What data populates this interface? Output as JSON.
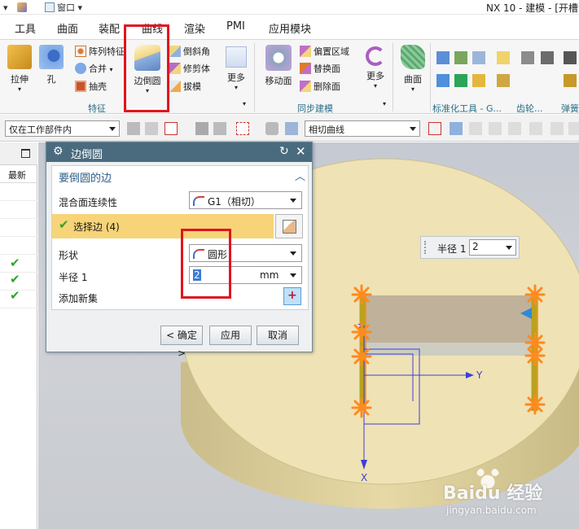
{
  "titlebar": {
    "window_label": "窗口",
    "title": "NX 10 - 建模 - [开槽"
  },
  "menu": {
    "tabs": [
      "工具",
      "曲面",
      "装配",
      "曲线",
      "渲染",
      "PMI",
      "应用模块"
    ]
  },
  "ribbon": {
    "extrude": "拉伸",
    "hole": "孔",
    "pattern": "阵列特征",
    "unite": "合并",
    "shell": "抽壳",
    "edge_blend": "边倒圆",
    "chamfer": "倒斜角",
    "trim_body": "修剪体",
    "draft": "拔模",
    "more1": "更多",
    "group_feature": "特征",
    "move_face": "移动面",
    "offset_region": "偏置区域",
    "replace_face": "替换面",
    "delete_face": "删除面",
    "more2": "更多",
    "group_sync": "同步建模",
    "surface": "曲面",
    "group_std": "标准化工具 - G...",
    "group_gear": "齿轮...",
    "group_spring": "弹簧"
  },
  "selbar": {
    "filter": "仅在工作部件内",
    "curve_rule": "相切曲线"
  },
  "leftpanel": {
    "column": "最新"
  },
  "dialog": {
    "title": "边倒圆",
    "section": "要倒圆的边",
    "continuity_label": "混合面连续性",
    "continuity_value": "G1（相切）",
    "select_edge": "选择边 (4)",
    "shape_label": "形状",
    "shape_value": "圆形",
    "radius_label": "半径 1",
    "radius_value": "2",
    "radius_unit": "mm",
    "add_set_label": "添加新集",
    "ok": "< 确定 >",
    "apply": "应用",
    "cancel": "取消"
  },
  "floating": {
    "label": "半径 1",
    "value": "2"
  },
  "axes": {
    "x": "X",
    "y": "Y",
    "z": "Z"
  },
  "watermark": {
    "brand": "Baidu 经验",
    "url": "jingyan.baidu.com"
  },
  "colors": {
    "highlight": "#e0151f",
    "dialog_title": "#4a6b7e",
    "selection_row": "#f7d478",
    "disc": "#efe2b4",
    "accent": "#2e5e8a"
  }
}
